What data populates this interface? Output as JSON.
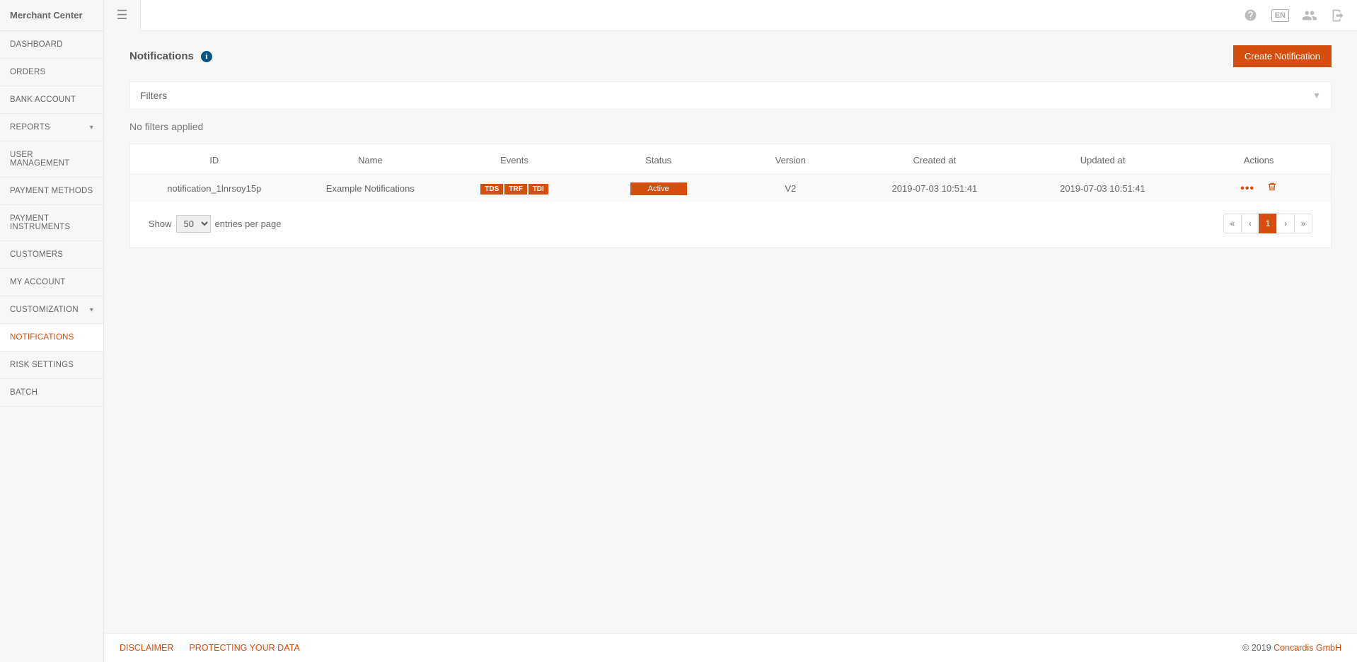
{
  "app_name": "Merchant Center",
  "topbar": {
    "language": "EN"
  },
  "sidebar": {
    "items": [
      {
        "label": "Dashboard",
        "has_chevron": false
      },
      {
        "label": "Orders",
        "has_chevron": false
      },
      {
        "label": "Bank Account",
        "has_chevron": false
      },
      {
        "label": "Reports",
        "has_chevron": true
      },
      {
        "label": "User Management",
        "has_chevron": false
      },
      {
        "label": "Payment Methods",
        "has_chevron": false
      },
      {
        "label": "Payment Instruments",
        "has_chevron": false
      },
      {
        "label": "Customers",
        "has_chevron": false
      },
      {
        "label": "My Account",
        "has_chevron": false
      },
      {
        "label": "Customization",
        "has_chevron": true
      },
      {
        "label": "Notifications",
        "has_chevron": false,
        "active": true
      },
      {
        "label": "Risk Settings",
        "has_chevron": false
      },
      {
        "label": "Batch",
        "has_chevron": false
      }
    ]
  },
  "page": {
    "title": "Notifications",
    "create_button": "Create Notification",
    "filters_label": "Filters",
    "no_filters_text": "No filters applied"
  },
  "table": {
    "headers": {
      "id": "ID",
      "name": "Name",
      "events": "Events",
      "status": "Status",
      "version": "Version",
      "created": "Created at",
      "updated": "Updated at",
      "actions": "Actions"
    },
    "rows": [
      {
        "id": "notification_1lnrsoy15p",
        "name": "Example Notifications",
        "events": [
          "TDS",
          "TRF",
          "TDI"
        ],
        "status": "Active",
        "version": "V2",
        "created": "2019-07-03 10:51:41",
        "updated": "2019-07-03 10:51:41"
      }
    ]
  },
  "entries": {
    "show": "Show",
    "per_page": "entries per page",
    "selected": "50"
  },
  "pagination": {
    "first": "«",
    "prev": "‹",
    "pages": [
      "1"
    ],
    "next": "›",
    "last": "»"
  },
  "footer": {
    "links": [
      "DISCLAIMER",
      "PROTECTING YOUR DATA"
    ],
    "copyright_prefix": "© 2019 ",
    "copyright_brand": "Concardis GmbH"
  }
}
